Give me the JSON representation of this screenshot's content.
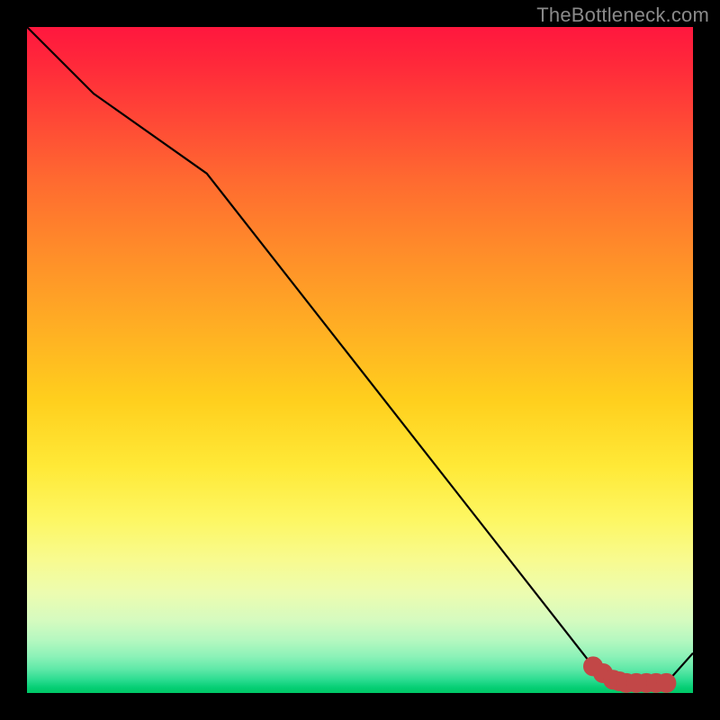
{
  "watermark": "TheBottleneck.com",
  "chart_data": {
    "type": "line",
    "title": "",
    "xlabel": "",
    "ylabel": "",
    "xlim": [
      0,
      100
    ],
    "ylim": [
      0,
      100
    ],
    "grid": false,
    "legend": false,
    "series": [
      {
        "name": "curve",
        "color": "#000000",
        "x": [
          0,
          10,
          27,
          85,
          88,
          90,
          93,
          96,
          100
        ],
        "y": [
          100,
          90,
          78,
          4,
          2,
          1.5,
          1.5,
          1.5,
          6
        ]
      }
    ],
    "markers": {
      "name": "highlight",
      "color": "#c24747",
      "x": [
        85,
        88,
        90,
        93,
        96
      ],
      "y": [
        4,
        2,
        1.5,
        1.5,
        1.5
      ]
    },
    "background_gradient": {
      "top": "#ff173e",
      "mid": "#ffe937",
      "bottom": "#00c866"
    }
  }
}
